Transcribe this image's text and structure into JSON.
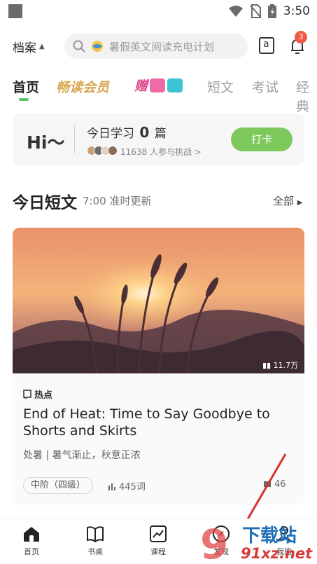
{
  "status": {
    "time": "3:50"
  },
  "header": {
    "archive_label": "档案",
    "search_placeholder": "暑假英文阅读充电计划",
    "notification_count": "3",
    "dict_icon_glyph": "a"
  },
  "tabs": [
    {
      "label": "首页"
    },
    {
      "label": "畅读会员"
    },
    {
      "label": "赠"
    },
    {
      "label": "短文"
    },
    {
      "label": "考试"
    },
    {
      "label": "经典"
    }
  ],
  "checkin": {
    "greeting": "Hi～",
    "today_prefix": "今日学习",
    "today_count": "0",
    "today_unit": "篇",
    "challenge": "11638 人参与挑战 >",
    "button": "打卡"
  },
  "section": {
    "title": "今日短文",
    "subtitle": "7:00 准时更新",
    "all": "全部"
  },
  "article": {
    "views": "11.7万",
    "tag": "热点",
    "title": "End of Heat: Time to Say Goodbye to Shorts and Skirts",
    "desc": "处暑 | 暑气渐止，秋意正浓",
    "level": "中阶（四级）",
    "words": "445词",
    "comments": "46"
  },
  "bottom_nav": [
    {
      "label": "首页",
      "icon": "home-icon"
    },
    {
      "label": "书桌",
      "icon": "book-icon"
    },
    {
      "label": "课程",
      "icon": "chart-icon"
    },
    {
      "label": "发现",
      "icon": "compass-icon"
    },
    {
      "label": "我的",
      "icon": "person-icon"
    }
  ],
  "watermark": {
    "line1": "下载站",
    "line2": "91xz.net",
    "number": "9"
  },
  "colors": {
    "accent": "#7cc85a",
    "vip": "#d8a74e",
    "badge": "#f05a4a"
  }
}
